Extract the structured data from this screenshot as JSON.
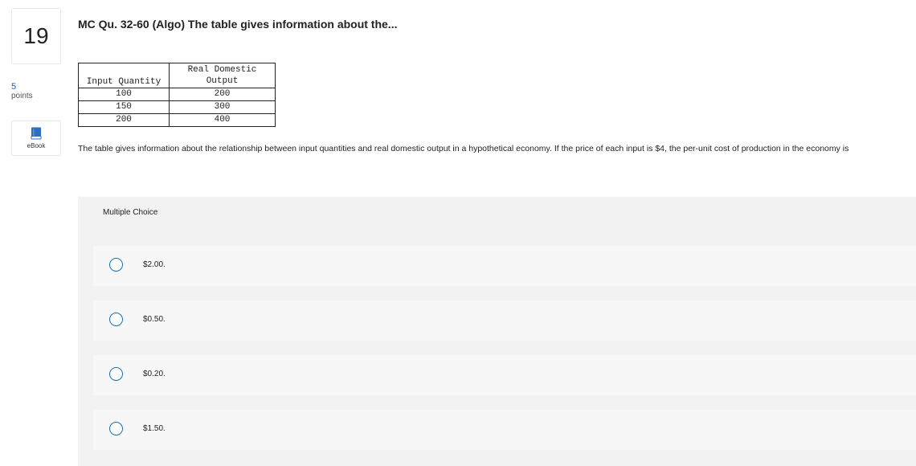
{
  "question": {
    "number": "19",
    "points_value": "5",
    "points_label": "points",
    "ebook_label": "eBook",
    "title": "MC Qu. 32-60 (Algo) The table gives information about the...",
    "text": "The table gives information about the relationship between input quantities and real domestic output in a hypothetical economy. If the price of each input is $4, the per-unit cost of production in the economy is"
  },
  "table": {
    "headers": [
      "Input Quantity",
      "Real Domestic Output"
    ],
    "rows": [
      [
        "100",
        "200"
      ],
      [
        "150",
        "300"
      ],
      [
        "200",
        "400"
      ]
    ]
  },
  "choices": {
    "header": "Multiple Choice",
    "options": [
      "$2.00.",
      "$0.50.",
      "$0.20.",
      "$1.50."
    ]
  },
  "colors": {
    "accent": "#1a6fb5",
    "panel_bg": "#f2f2f2",
    "choice_bg": "#f7f7f7"
  }
}
